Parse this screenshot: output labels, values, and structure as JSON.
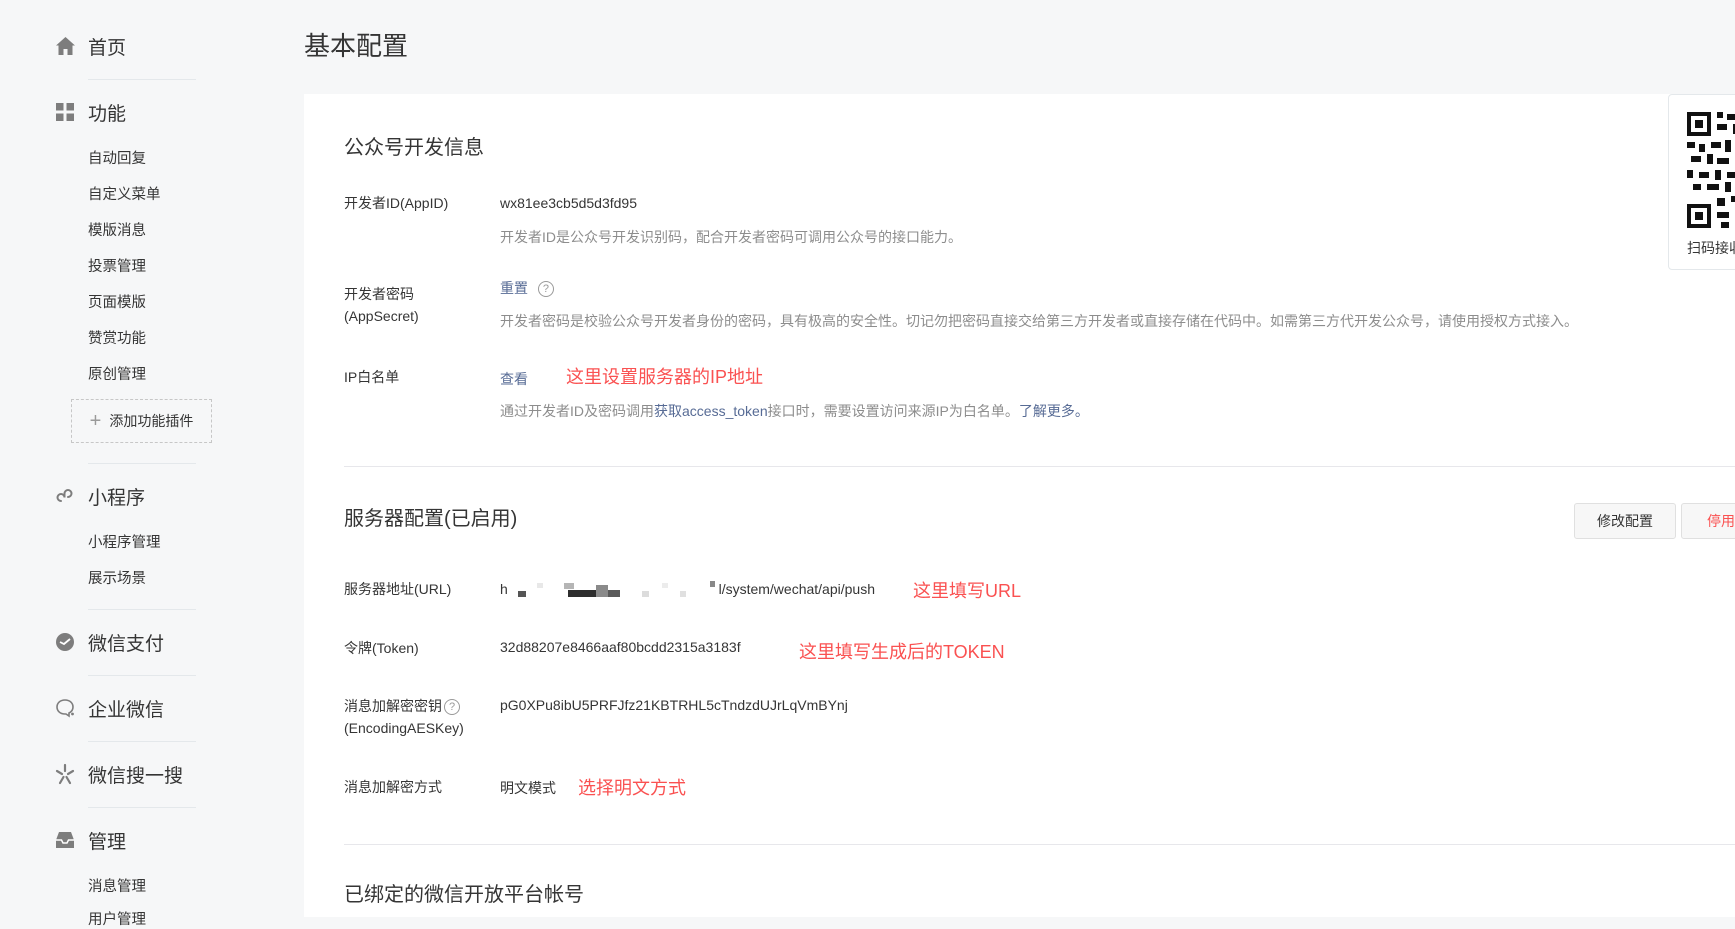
{
  "page": {
    "title": "基本配置"
  },
  "sidebar": {
    "home": {
      "label": "首页",
      "icon": "home-icon"
    },
    "features": {
      "label": "功能",
      "icon": "grid-icon",
      "items": [
        "自动回复",
        "自定义菜单",
        "模版消息",
        "投票管理",
        "页面模版",
        "赞赏功能",
        "原创管理"
      ],
      "add_plugin": "添加功能插件"
    },
    "miniprogram": {
      "label": "小程序",
      "icon": "link-icon",
      "items": [
        "小程序管理",
        "展示场景"
      ]
    },
    "wechat_pay": {
      "label": "微信支付",
      "icon": "pay-icon"
    },
    "wecom": {
      "label": "企业微信",
      "icon": "chat-icon"
    },
    "search": {
      "label": "微信搜一搜",
      "icon": "search-spark-icon"
    },
    "manage": {
      "label": "管理",
      "icon": "inbox-icon",
      "items": [
        "消息管理",
        "用户管理"
      ]
    }
  },
  "dev_info": {
    "title": "公众号开发信息",
    "appid": {
      "label": "开发者ID(AppID)",
      "value": "wx81ee3cb5d5d3fd95",
      "desc": "开发者ID是公众号开发识别码，配合开发者密码可调用公众号的接口能力。"
    },
    "secret": {
      "label_line1": "开发者密码",
      "label_line2": "(AppSecret)",
      "action": "重置",
      "help": "?",
      "desc": "开发者密码是校验公众号开发者身份的密码，具有极高的安全性。切记勿把密码直接交给第三方开发者或直接存储在代码中。如需第三方代开发公众号，请使用授权方式接入。"
    },
    "ip_whitelist": {
      "label": "IP白名单",
      "action": "查看",
      "note": "这里设置服务器的IP地址",
      "desc_prefix": "通过开发者ID及密码调用",
      "desc_link": "获取access_token",
      "desc_middle": "接口时，需要设置访问来源IP为白名单。",
      "desc_link2": "了解更多。"
    }
  },
  "server_config": {
    "title": "服务器配置(已启用)",
    "modify_button": "修改配置",
    "disable_button": "停用",
    "url": {
      "label": "服务器地址(URL)",
      "value_prefix": "h",
      "value_suffix": "l/system/wechat/api/push",
      "note": "这里填写URL"
    },
    "token": {
      "label": "令牌(Token)",
      "value": "32d88207e8466aaf80bcdd2315a3183f",
      "note": "这里填写生成后的TOKEN"
    },
    "aes_key": {
      "label_line1": "消息加解密密钥",
      "label_line2": "(EncodingAESKey)",
      "help": "?",
      "value": "pG0XPu8ibU5PRFJfz21KBTRHL5cTndzdUJrLqVmBYnj"
    },
    "encrypt_mode": {
      "label": "消息加解密方式",
      "value": "明文模式",
      "note": "选择明文方式"
    }
  },
  "open_platform": {
    "title": "已绑定的微信开放平台帐号"
  },
  "qr_panel": {
    "caption": "扫码接收"
  },
  "colors": {
    "note_red": "#fa5151",
    "link_blue": "#576b95",
    "disable_red": "#fa5151"
  }
}
